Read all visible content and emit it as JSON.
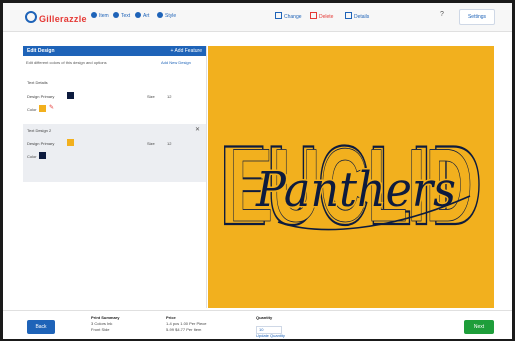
{
  "topbar": {
    "logo": "Gillerazzle",
    "steps": [
      "Item",
      "Text",
      "Art",
      "Style"
    ],
    "links": [
      "Change",
      "Delete",
      "Details"
    ],
    "help_label": "?",
    "settings_label": "Settings"
  },
  "sidebar": {
    "header_title": "Edit Design",
    "header_action": "+ Add Feature",
    "subtitle": "Edit different colors of this design and options",
    "subtitle_link": "Add New Design",
    "section1": {
      "title": "Text Details",
      "primary_label": "Design Primary",
      "size_label": "Size",
      "size_value": "12",
      "fill_label": "Color"
    },
    "section2": {
      "title": "Text Design 2",
      "primary_label": "Design Primary",
      "size_label": "Size",
      "size_value": "12",
      "fill_label": "Color"
    }
  },
  "canvas": {
    "block_text": "EUCLID",
    "script_text": "Panthers",
    "background": "#f2b01e",
    "ink": "#0d1b3e"
  },
  "footer": {
    "back_label": "Back",
    "col1": {
      "heading": "Print Summary",
      "line1": "3 Colors Ink",
      "line2": "Front Side"
    },
    "col2": {
      "heading": "Price",
      "line1": "1-4 pcs 1.00 Per Piece",
      "line2": "5-99 $4.77 Per Item"
    },
    "col3": {
      "heading": "Quantity",
      "qty": "10",
      "link": "Update Quantity"
    },
    "next_label": "Next"
  },
  "colors": {
    "primary": "#1e63b8",
    "accent": "#e53935",
    "navy": "#0d1b3e",
    "gold": "#f2b01e",
    "success": "#1e9e3a"
  }
}
